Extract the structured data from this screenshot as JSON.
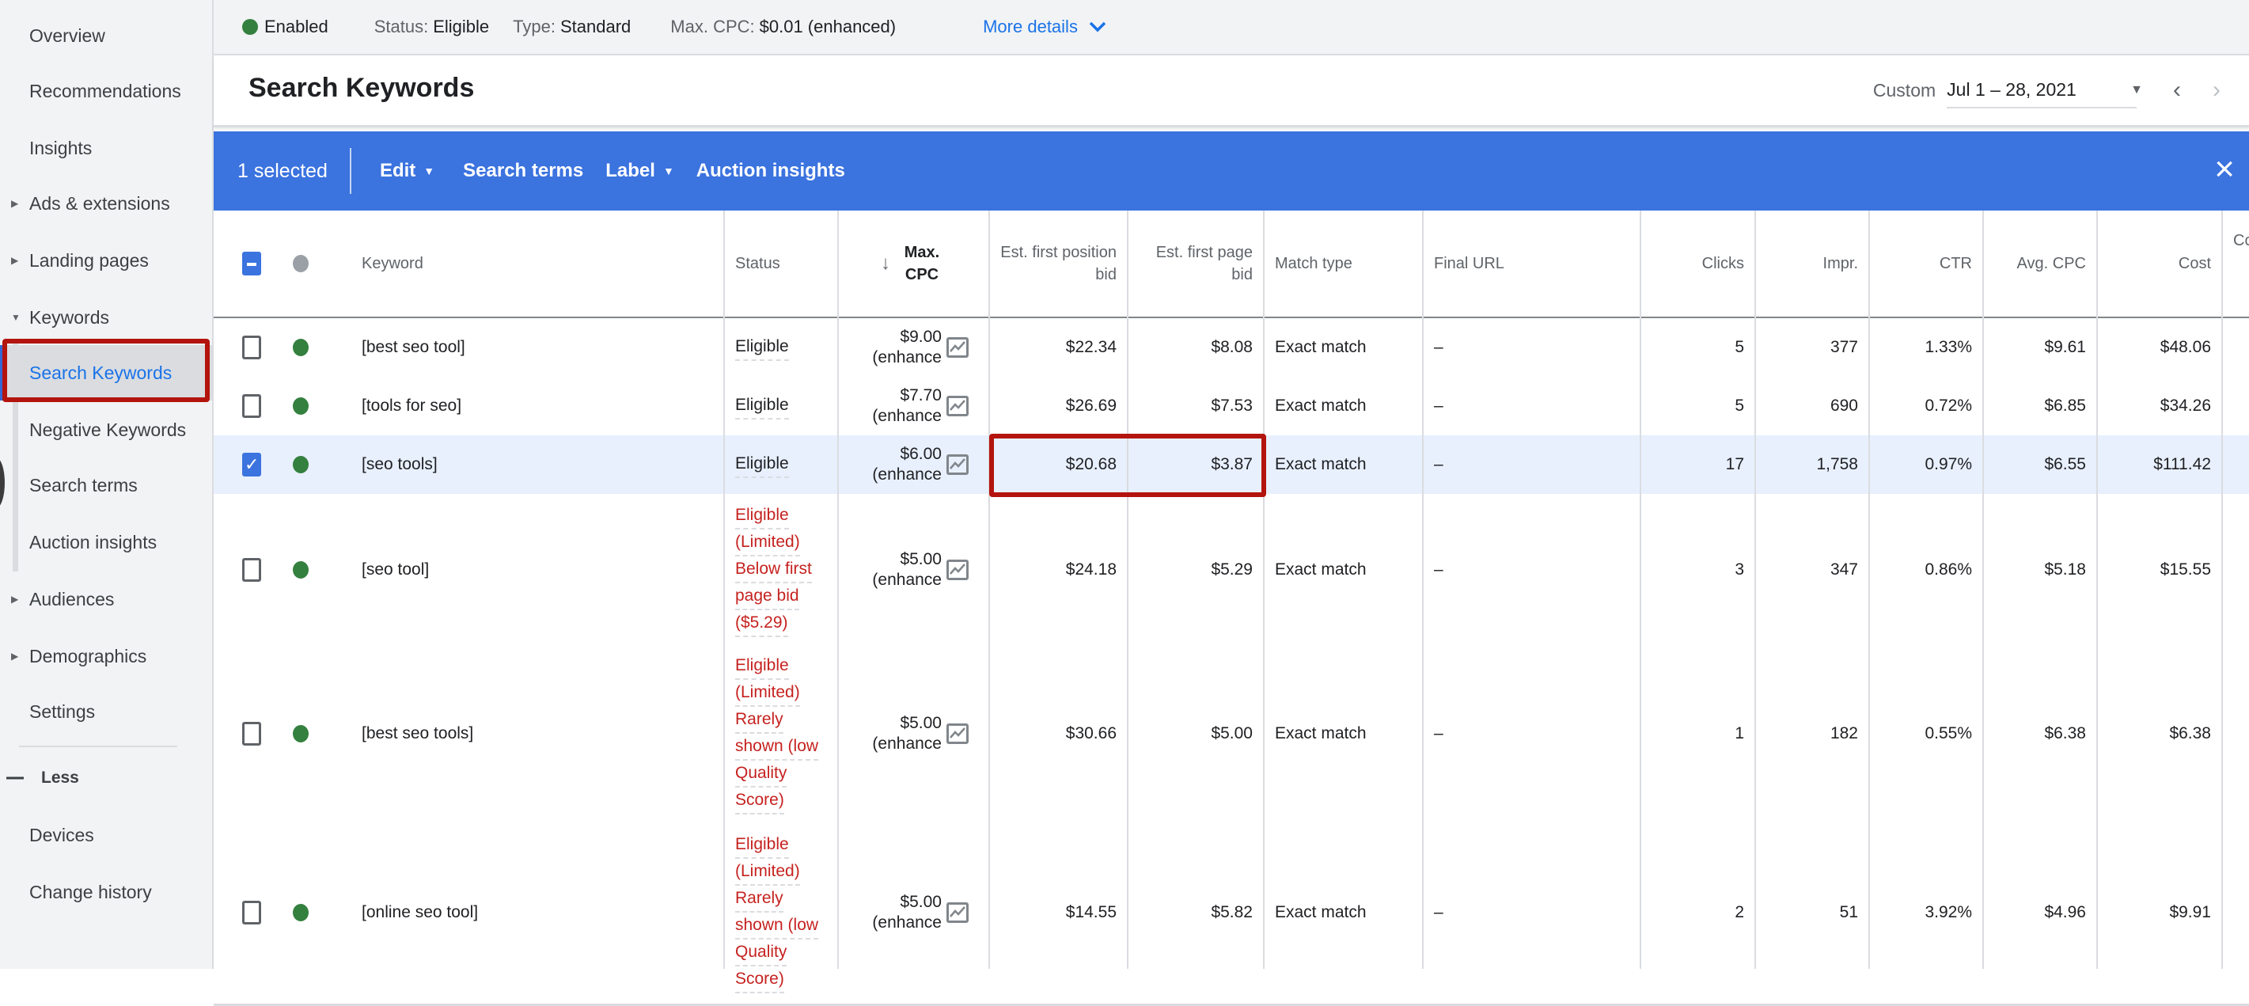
{
  "sidebar": {
    "items": [
      {
        "label": "Overview",
        "expander": ""
      },
      {
        "label": "Recommendations",
        "expander": ""
      },
      {
        "label": "Insights",
        "expander": ""
      },
      {
        "label": "Ads & extensions",
        "expander": "▶"
      },
      {
        "label": "Landing pages",
        "expander": "▶"
      },
      {
        "label": "Keywords",
        "expander": "▼"
      },
      {
        "label": "Search Keywords",
        "expander": "",
        "active": true
      },
      {
        "label": "Negative Keywords",
        "expander": ""
      },
      {
        "label": "Search terms",
        "expander": ""
      },
      {
        "label": "Auction insights",
        "expander": ""
      },
      {
        "label": "Audiences",
        "expander": "▶"
      },
      {
        "label": "Demographics",
        "expander": "▶"
      },
      {
        "label": "Settings",
        "expander": ""
      }
    ],
    "less_label": "Less",
    "extra_items": [
      {
        "label": "Devices"
      },
      {
        "label": "Change history"
      }
    ]
  },
  "infobar": {
    "enabled_label": "Enabled",
    "status_label": "Status:",
    "status_value": "Eligible",
    "type_label": "Type:",
    "type_value": "Standard",
    "maxcpc_label": "Max. CPC:",
    "maxcpc_value": "$0.01 (enhanced)",
    "more_details": "More details",
    "more_icon": "⌄"
  },
  "header": {
    "title": "Search Keywords",
    "date_preset": "Custom",
    "date_range": "Jul 1 – 28, 2021",
    "caret": "▼",
    "prev": "‹",
    "next": "›"
  },
  "actionbar": {
    "selected": "1 selected",
    "edit": "Edit",
    "search_terms": "Search terms",
    "label": "Label",
    "auction_insights": "Auction insights",
    "caret": "▼",
    "close": "×"
  },
  "table": {
    "columns": {
      "keyword": "Keyword",
      "status": "Status",
      "sort_arrow": "↓",
      "max_cpc": "Max. CPC",
      "est_first_position_bid": "Est. first position bid",
      "est_first_page_bid": "Est. first page bid",
      "match_type": "Match type",
      "final_url": "Final URL",
      "clicks": "Clicks",
      "impr": "Impr.",
      "ctr": "CTR",
      "avg_cpc": "Avg. CPC",
      "cost": "Cost",
      "partial": "Co"
    },
    "rows": [
      {
        "checked": false,
        "keyword": "[best seo tool]",
        "status": [
          "Eligible"
        ],
        "limited": false,
        "max_cpc": "$9.00",
        "max_cpc_note": "(enhance",
        "est_first_position_bid": "$22.34",
        "est_first_page_bid": "$8.08",
        "match_type": "Exact match",
        "final_url": "–",
        "clicks": "5",
        "impr": "377",
        "ctr": "1.33%",
        "avg_cpc": "$9.61",
        "cost": "$48.06"
      },
      {
        "checked": false,
        "keyword": "[tools for seo]",
        "status": [
          "Eligible"
        ],
        "limited": false,
        "max_cpc": "$7.70",
        "max_cpc_note": "(enhance",
        "est_first_position_bid": "$26.69",
        "est_first_page_bid": "$7.53",
        "match_type": "Exact match",
        "final_url": "–",
        "clicks": "5",
        "impr": "690",
        "ctr": "0.72%",
        "avg_cpc": "$6.85",
        "cost": "$34.26"
      },
      {
        "checked": true,
        "keyword": "[seo tools]",
        "status": [
          "Eligible"
        ],
        "limited": false,
        "max_cpc": "$6.00",
        "max_cpc_note": "(enhance",
        "est_first_position_bid": "$20.68",
        "est_first_page_bid": "$3.87",
        "match_type": "Exact match",
        "final_url": "–",
        "clicks": "17",
        "impr": "1,758",
        "ctr": "0.97%",
        "avg_cpc": "$6.55",
        "cost": "$111.42"
      },
      {
        "checked": false,
        "keyword": "[seo tool]",
        "status": [
          "Eligible",
          "(Limited)",
          "Below first",
          "page bid",
          "($5.29)"
        ],
        "limited": true,
        "max_cpc": "$5.00",
        "max_cpc_note": "(enhance",
        "est_first_position_bid": "$24.18",
        "est_first_page_bid": "$5.29",
        "match_type": "Exact match",
        "final_url": "–",
        "clicks": "3",
        "impr": "347",
        "ctr": "0.86%",
        "avg_cpc": "$5.18",
        "cost": "$15.55"
      },
      {
        "checked": false,
        "keyword": "[best seo tools]",
        "status": [
          "Eligible",
          "(Limited)",
          "Rarely",
          "shown (low",
          "Quality",
          "Score)"
        ],
        "limited": true,
        "max_cpc": "$5.00",
        "max_cpc_note": "(enhance",
        "est_first_position_bid": "$30.66",
        "est_first_page_bid": "$5.00",
        "match_type": "Exact match",
        "final_url": "–",
        "clicks": "1",
        "impr": "182",
        "ctr": "0.55%",
        "avg_cpc": "$6.38",
        "cost": "$6.38"
      },
      {
        "checked": false,
        "keyword": "[online seo tool]",
        "status": [
          "Eligible",
          "(Limited)",
          "Rarely",
          "shown (low",
          "Quality",
          "Score)"
        ],
        "limited": true,
        "max_cpc": "$5.00",
        "max_cpc_note": "(enhance",
        "est_first_position_bid": "$14.55",
        "est_first_page_bid": "$5.82",
        "match_type": "Exact match",
        "final_url": "–",
        "clicks": "2",
        "impr": "51",
        "ctr": "3.92%",
        "avg_cpc": "$4.96",
        "cost": "$9.91"
      }
    ]
  },
  "colors": {
    "accent_blue": "#3b73df",
    "link_blue": "#1a73e8",
    "enabled_green": "#34803f",
    "limited_red": "#c5221f",
    "annotation_red": "#b3140d",
    "selected_row": "#e8f0fe"
  }
}
